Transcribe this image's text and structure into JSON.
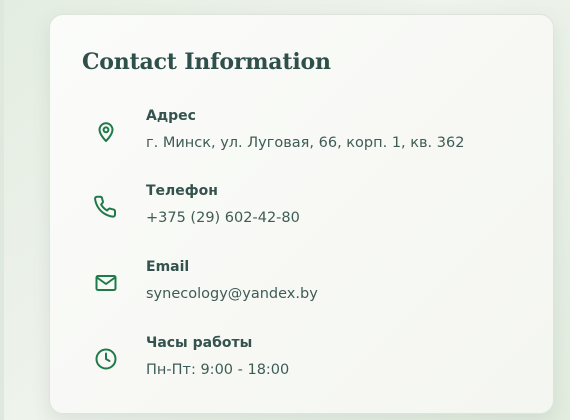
{
  "contact": {
    "title": "Contact Information",
    "accent_color": "#1f7a4a",
    "items": [
      {
        "icon": "map-pin-icon",
        "label": "Адрес",
        "value": "г. Минск, ул. Луговая, 66, корп. 1, кв. 362"
      },
      {
        "icon": "phone-icon",
        "label": "Телефон",
        "value": "+375 (29) 602-42-80"
      },
      {
        "icon": "mail-icon",
        "label": "Email",
        "value": "synecology@yandex.by"
      },
      {
        "icon": "clock-icon",
        "label": "Часы работы",
        "value": "Пн-Пт: 9:00 - 18:00"
      }
    ]
  }
}
